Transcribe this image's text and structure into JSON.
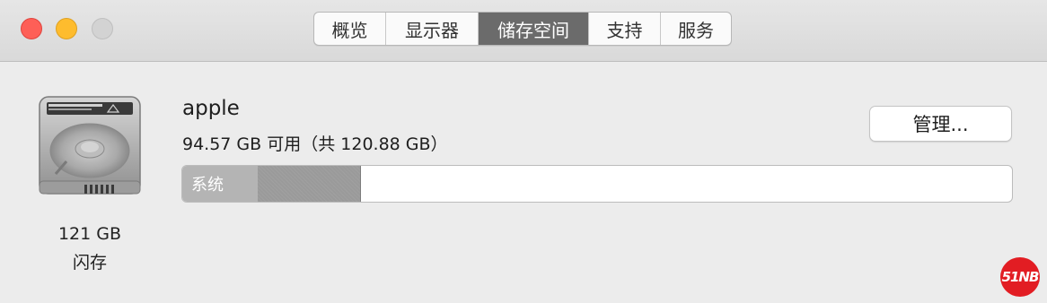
{
  "tabs": [
    {
      "label": "概览",
      "active": false
    },
    {
      "label": "显示器",
      "active": false
    },
    {
      "label": "储存空间",
      "active": true
    },
    {
      "label": "支持",
      "active": false
    },
    {
      "label": "服务",
      "active": false
    }
  ],
  "disk": {
    "icon": "hard-drive-icon",
    "capacity": "121 GB",
    "type": "闪存",
    "name": "apple",
    "available": "94.57 GB 可用（共 120.88 GB）"
  },
  "storage_bar": {
    "segments": [
      {
        "label": "系统",
        "fraction": 0.091
      },
      {
        "label": "",
        "fraction": 0.124
      }
    ]
  },
  "manage_button": {
    "label": "管理..."
  },
  "watermark": {
    "text": "51NB"
  },
  "colors": {
    "close": "#fe5f57",
    "minimize": "#febc2e",
    "zoom_disabled": "#d3d3d3",
    "active_tab": "#6b6b6b",
    "system_segment": "#b4b4b4",
    "other_segment": "#9a9a9a",
    "watermark": "#e21d23"
  }
}
